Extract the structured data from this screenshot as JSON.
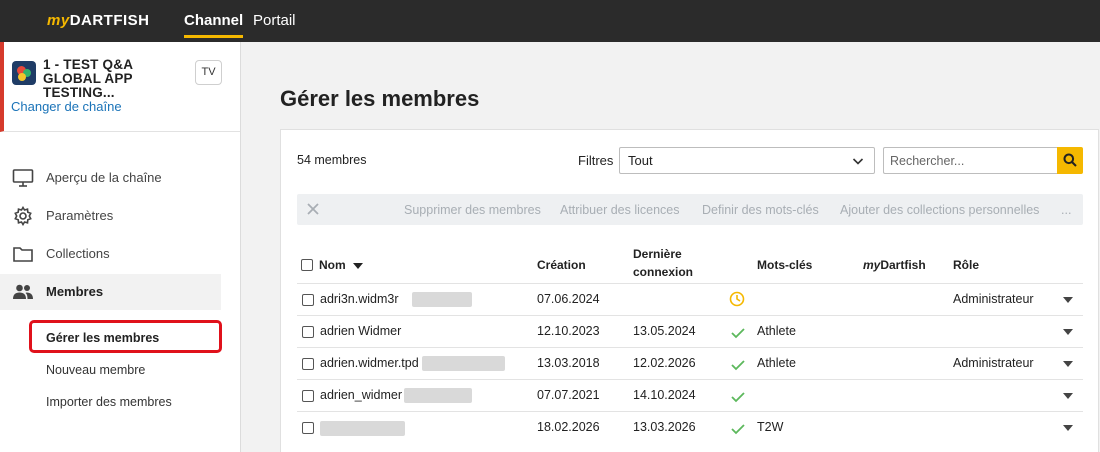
{
  "header": {
    "logo_my": "my",
    "logo_brand": "DARTFISH",
    "tabs": [
      {
        "label": "Channel",
        "active": true
      },
      {
        "label": "Portail",
        "active": false
      }
    ]
  },
  "sidebar": {
    "channel": {
      "title": "1 - TEST Q&A GLOBAL APP TESTING...",
      "badge": "TV",
      "change_link": "Changer de chaîne"
    },
    "menu": [
      {
        "label": "Aperçu de la chaîne",
        "icon": "monitor-icon"
      },
      {
        "label": "Paramètres",
        "icon": "gear-icon"
      },
      {
        "label": "Collections",
        "icon": "folder-icon"
      },
      {
        "label": "Membres",
        "icon": "users-icon",
        "active": true
      }
    ],
    "submenu": [
      {
        "label": "Gérer les membres",
        "current": true
      },
      {
        "label": "Nouveau membre"
      },
      {
        "label": "Importer des membres"
      }
    ]
  },
  "main": {
    "title": "Gérer les membres",
    "member_count": "54 membres",
    "filters_label": "Filtres",
    "filter_value": "Tout",
    "search_placeholder": "Rechercher...",
    "actions": [
      "Supprimer des membres",
      "Attribuer des licences",
      "Definir des mots-clés",
      "Ajouter des collections personnelles",
      "..."
    ],
    "columns": {
      "name": "Nom",
      "creation": "Création",
      "last_login_1": "Dernière",
      "last_login_2": "connexion",
      "keywords": "Mots-clés",
      "mydartfish_my": "my",
      "mydartfish_brand": "Dartfish",
      "role": "Rôle"
    },
    "rows": [
      {
        "name": "adri3n.widm3r",
        "created": "07.06.2024",
        "last_login": "",
        "status": "pending",
        "keywords": "",
        "role": "Administrateur"
      },
      {
        "name": "adrien Widmer",
        "created": "12.10.2023",
        "last_login": "13.05.2024",
        "status": "ok",
        "keywords": "Athlete",
        "role": ""
      },
      {
        "name": "adrien.widmer.tpd",
        "created": "13.03.2018",
        "last_login": "12.02.2026",
        "status": "ok",
        "keywords": "Athlete",
        "role": "Administrateur"
      },
      {
        "name": "adrien_widmer",
        "created": "07.07.2021",
        "last_login": "14.10.2024",
        "status": "ok",
        "keywords": "",
        "role": ""
      },
      {
        "name": "",
        "created": "18.02.2026",
        "last_login": "13.03.2026",
        "status": "ok",
        "keywords": "T2W",
        "role": ""
      }
    ]
  },
  "colors": {
    "accent": "#f5b800",
    "topbar": "#2b2b2b",
    "success": "#5cb85c",
    "highlight": "#e0111b",
    "link": "#1a73b8"
  }
}
